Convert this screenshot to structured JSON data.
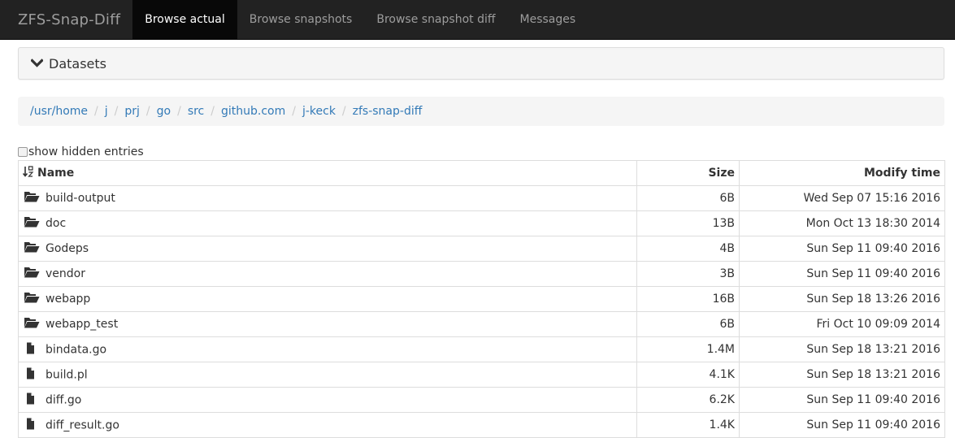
{
  "navbar": {
    "brand": "ZFS-Snap-Diff",
    "tabs": [
      {
        "label": "Browse actual",
        "active": true
      },
      {
        "label": "Browse snapshots"
      },
      {
        "label": "Browse snapshot diff"
      },
      {
        "label": "Messages"
      }
    ]
  },
  "datasets_panel": {
    "label": "Datasets",
    "icon": "chevron-down-icon"
  },
  "breadcrumb": [
    "/usr/home",
    "j",
    "prj",
    "go",
    "src",
    "github.com",
    "j-keck",
    "zfs-snap-diff"
  ],
  "show_hidden": {
    "label": "show hidden entries",
    "checked": false
  },
  "table": {
    "headers": {
      "name": "Name",
      "size": "Size",
      "mtime": "Modify time"
    },
    "rows": [
      {
        "type": "folder",
        "name": "build-output",
        "size": "6B",
        "mtime": "Wed Sep 07 15:16 2016"
      },
      {
        "type": "folder",
        "name": "doc",
        "size": "13B",
        "mtime": "Mon Oct 13 18:30 2014"
      },
      {
        "type": "folder",
        "name": "Godeps",
        "size": "4B",
        "mtime": "Sun Sep 11 09:40 2016"
      },
      {
        "type": "folder",
        "name": "vendor",
        "size": "3B",
        "mtime": "Sun Sep 11 09:40 2016"
      },
      {
        "type": "folder",
        "name": "webapp",
        "size": "16B",
        "mtime": "Sun Sep 18 13:26 2016"
      },
      {
        "type": "folder",
        "name": "webapp_test",
        "size": "6B",
        "mtime": "Fri Oct 10 09:09 2014"
      },
      {
        "type": "file",
        "name": "bindata.go",
        "size": "1.4M",
        "mtime": "Sun Sep 18 13:21 2016"
      },
      {
        "type": "file",
        "name": "build.pl",
        "size": "4.1K",
        "mtime": "Sun Sep 18 13:21 2016"
      },
      {
        "type": "file",
        "name": "diff.go",
        "size": "6.2K",
        "mtime": "Sun Sep 11 09:40 2016"
      },
      {
        "type": "file",
        "name": "diff_result.go",
        "size": "1.4K",
        "mtime": "Sun Sep 11 09:40 2016"
      }
    ]
  },
  "colors": {
    "navbar_bg": "#222222",
    "active_tab_bg": "#080808",
    "link": "#337ab7",
    "panel_bg": "#f5f5f5"
  }
}
